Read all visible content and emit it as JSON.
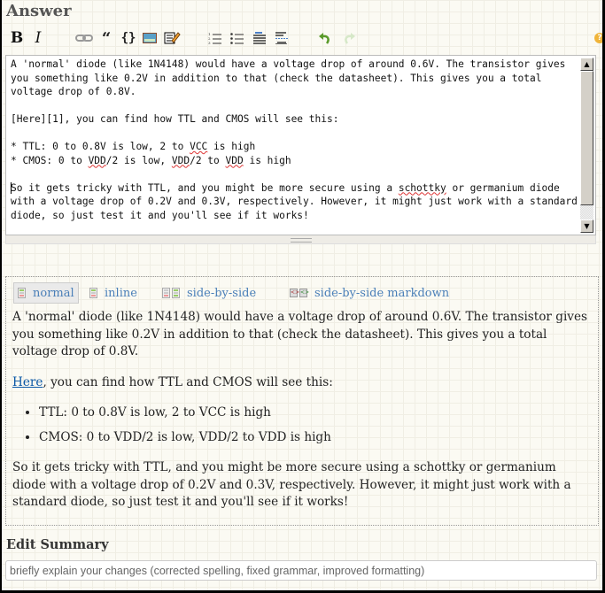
{
  "header": {
    "title": "Answer"
  },
  "toolbar": {
    "bold": "B",
    "italic": "I",
    "quote": "“",
    "code": "{}",
    "icons": [
      "bold-icon",
      "italic-icon",
      "link-icon",
      "blockquote-icon",
      "code-icon",
      "image-icon",
      "html-snippet-icon",
      "numbered-list-icon",
      "bulleted-list-icon",
      "heading-icon",
      "horizontal-rule-icon",
      "undo-icon",
      "redo-icon"
    ],
    "help": "?"
  },
  "editor": {
    "line1": "A 'normal' diode (like 1N4148) would have a voltage drop of around 0.6V. The transistor gives you something like 0.2V in addition to that (check the datasheet). This gives you a total voltage drop of 0.8V.",
    "line2": "[Here][1], you can find how TTL and CMOS will see this:",
    "bullet1_pre": "* TTL: 0 to 0.8V is low, 2 to ",
    "bullet1_sq": "VCC",
    "bullet1_post": " is high",
    "bullet2_pre": "* CMOS: 0 to ",
    "bullet2_sq1": "VDD",
    "bullet2_mid1": "/2 is low, ",
    "bullet2_sq2": "VDD",
    "bullet2_mid2": "/2 to ",
    "bullet2_sq3": "VDD",
    "bullet2_post": " is high",
    "para3_first": "S",
    "para3_pre": "o it gets tricky with TTL, and you might be more secure using a ",
    "para3_sq": "schottky",
    "para3_post": " or germanium diode with a voltage drop of 0.2V and 0.3V, respectively. However, it might just work with a standard diode, so just test it and you'll see if it works!"
  },
  "preview_tabs": [
    {
      "label": "normal",
      "active": true
    },
    {
      "label": "inline",
      "active": false
    },
    {
      "label": "side-by-side",
      "active": false
    },
    {
      "label": "side-by-side markdown",
      "active": false
    }
  ],
  "preview": {
    "para1": "A 'normal' diode (like 1N4148) would have a voltage drop of around 0.6V. The transistor gives you something like 0.2V in addition to that (check the datasheet). This gives you a total voltage drop of 0.8V.",
    "link_text": "Here",
    "para2_rest": ", you can find how TTL and CMOS will see this:",
    "bullets": [
      "TTL: 0 to 0.8V is low, 2 to VCC is high",
      "CMOS: 0 to VDD/2 is low, VDD/2 to VDD is high"
    ],
    "para3": "So it gets tricky with TTL, and you might be more secure using a schottky or germanium diode with a voltage drop of 0.2V and 0.3V, respectively. However, it might just work with a standard diode, so just test it and you'll see if it works!"
  },
  "summary": {
    "title": "Edit Summary",
    "placeholder": "briefly explain your changes (corrected spelling, fixed grammar, improved formatting)",
    "value": ""
  }
}
